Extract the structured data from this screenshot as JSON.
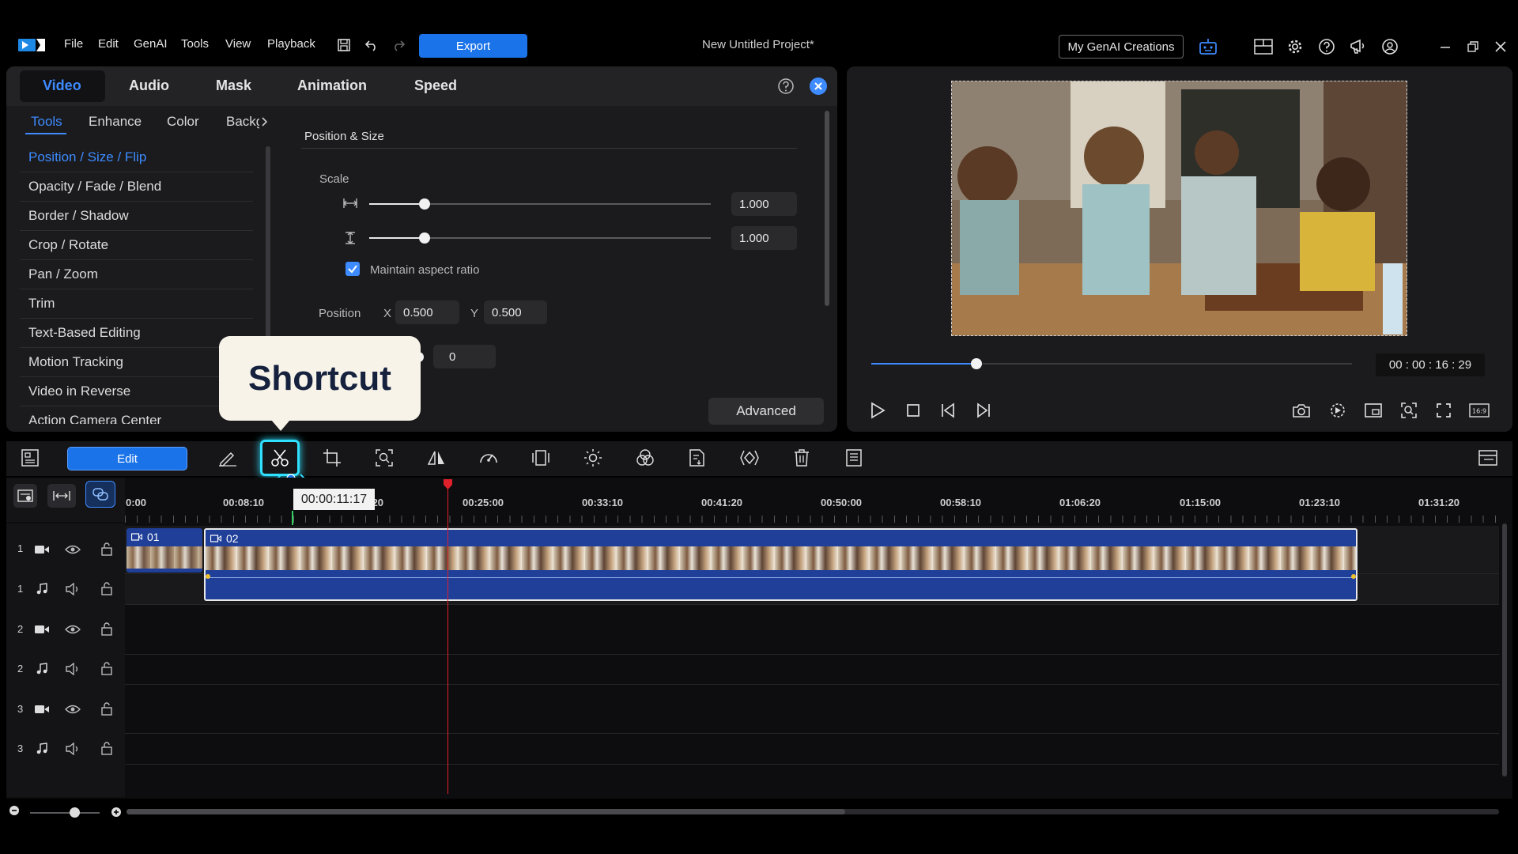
{
  "menu": {
    "file": "File",
    "edit": "Edit",
    "genai": "GenAI",
    "tools": "Tools",
    "view": "View",
    "playback": "Playback"
  },
  "export_label": "Export",
  "project_title": "New Untitled Project*",
  "genai_creations_label": "My GenAI Creations",
  "top_tabs": {
    "video": "Video",
    "audio": "Audio",
    "mask": "Mask",
    "animation": "Animation",
    "speed": "Speed"
  },
  "sub_tabs": {
    "tools": "Tools",
    "enhance": "Enhance",
    "color": "Color",
    "background": "Backg"
  },
  "tools_list": [
    "Position / Size / Flip",
    "Opacity / Fade / Blend",
    "Border / Shadow",
    "Crop / Rotate",
    "Pan / Zoom",
    "Trim",
    "Text-Based Editing",
    "Motion Tracking",
    "Video in Reverse",
    "Action Camera Center"
  ],
  "position_size": {
    "section_title": "Position & Size",
    "scale_label": "Scale",
    "scale_width": "1.000",
    "scale_height": "1.000",
    "scale_width_level": 0.15,
    "scale_height_level": 0.15,
    "maintain_aspect_label": "Maintain aspect ratio",
    "maintain_aspect_checked": true,
    "position_label": "Position",
    "x_label": "X",
    "x_value": "0.500",
    "y_label": "Y",
    "y_value": "0.500",
    "rotation_value": "0"
  },
  "advanced_label": "Advanced",
  "tooltip_shortcut": "Shortcut",
  "preview": {
    "timecode": "00 : 00 : 16 : 29",
    "progress": 0.22
  },
  "edit_label": "Edit",
  "hover_timecode": "00:00:11:17",
  "ruler_ticks": [
    "0:00",
    "00:08:10",
    "00:16:20",
    "00:25:00",
    "00:33:10",
    "00:41:20",
    "00:50:00",
    "00:58:10",
    "01:06:20",
    "01:15:00",
    "01:23:10",
    "01:31:20"
  ],
  "clips": [
    {
      "name": "01"
    },
    {
      "name": "02"
    }
  ],
  "tracks": [
    {
      "num": "1",
      "type": "video"
    },
    {
      "num": "1",
      "type": "audio"
    },
    {
      "num": "2",
      "type": "video"
    },
    {
      "num": "2",
      "type": "audio"
    },
    {
      "num": "3",
      "type": "video"
    },
    {
      "num": "3",
      "type": "audio"
    }
  ],
  "colors": {
    "accent": "#1a73e8",
    "highlight_cyan": "#2fe0ff",
    "playhead": "#e0202a",
    "clip_blue": "#1f3f99",
    "panel_bg": "#1b1b1d"
  }
}
